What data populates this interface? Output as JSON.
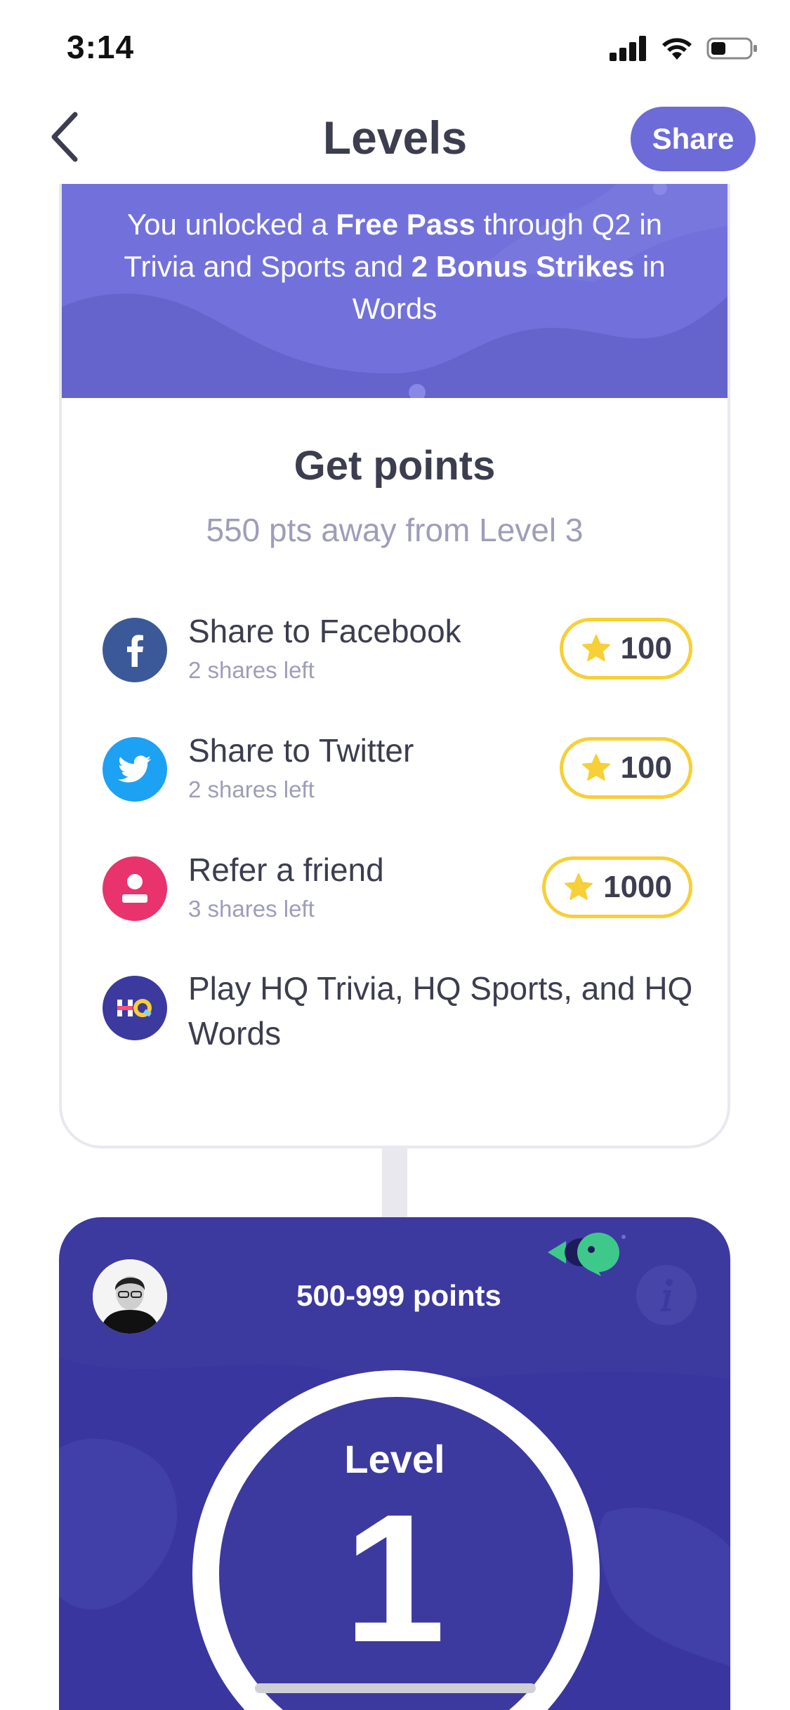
{
  "status_bar": {
    "time": "3:14"
  },
  "nav": {
    "title": "Levels",
    "share_label": "Share"
  },
  "banner": {
    "text_1": "You unlocked a ",
    "bold_1": "Free Pass",
    "text_2": " through Q2 in Trivia and Sports and ",
    "bold_2": "2 Bonus Strikes",
    "text_3": " in Words"
  },
  "points_card": {
    "title": "Get points",
    "subtitle": "550 pts away from Level 3",
    "actions": [
      {
        "title": "Share to Facebook",
        "subtitle": "2 shares left",
        "points": "100",
        "icon": "facebook-icon",
        "color": "#3b5998"
      },
      {
        "title": "Share to Twitter",
        "subtitle": "2 shares left",
        "points": "100",
        "icon": "twitter-icon",
        "color": "#1da1f2"
      },
      {
        "title": "Refer a friend",
        "subtitle": "3 shares left",
        "points": "1000",
        "icon": "person-icon",
        "color": "#e8336d"
      },
      {
        "title": "Play HQ Trivia, HQ Sports, and HQ Words",
        "icon": "hq-logo-icon",
        "color": "#3c3a9f"
      }
    ]
  },
  "level_card": {
    "points_range": "500-999 points",
    "level_label": "Level",
    "level_number": "1"
  },
  "colors": {
    "accent": "#6d6bd8",
    "banner": "#7271db",
    "level_card": "#3c3a9f",
    "points_border": "#f7cf36",
    "star": "#f7cf36"
  }
}
